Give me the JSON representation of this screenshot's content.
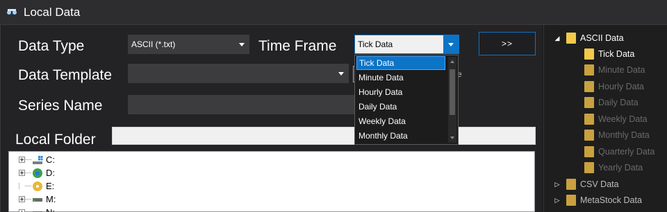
{
  "window": {
    "title": "Local Data",
    "icon": "app-logo-icon"
  },
  "form": {
    "data_type_label": "Data Type",
    "data_type_value": "ASCII (*.txt)",
    "time_frame_label": "Time Frame",
    "time_frame_value": "Tick Data",
    "data_template_label": "Data Template",
    "data_template_value": "",
    "series_name_label": "Series Name",
    "series_name_value": "",
    "local_folder_label": "Local Folder",
    "local_folder_value": "",
    "go_button_label": ">>",
    "partial_checkbox_text": "e"
  },
  "time_frame_options": [
    "Tick Data",
    "Minute Data",
    "Hourly Data",
    "Daily Data",
    "Weekly Data",
    "Monthly Data"
  ],
  "drives": [
    {
      "label": "C:",
      "icon": "windows-drive-icon"
    },
    {
      "label": "D:",
      "icon": "network-drive-icon"
    },
    {
      "label": "E:",
      "icon": "cd-drive-icon"
    },
    {
      "label": "M:",
      "icon": "hard-drive-icon"
    },
    {
      "label": "N:",
      "icon": "hard-drive-icon"
    }
  ],
  "right_tree": {
    "root": "ASCII Data",
    "children": [
      "Tick Data",
      "Minute Data",
      "Hourly Data",
      "Daily Data",
      "Weekly Data",
      "Monthly Data",
      "Quarterly Data",
      "Yearly Data"
    ],
    "active_child": "Tick Data",
    "others": [
      "CSV Data",
      "MetaStock Data"
    ]
  },
  "colors": {
    "accent": "#0b74c7",
    "folder": "#f3c94a",
    "background": "#1e1e1e"
  }
}
